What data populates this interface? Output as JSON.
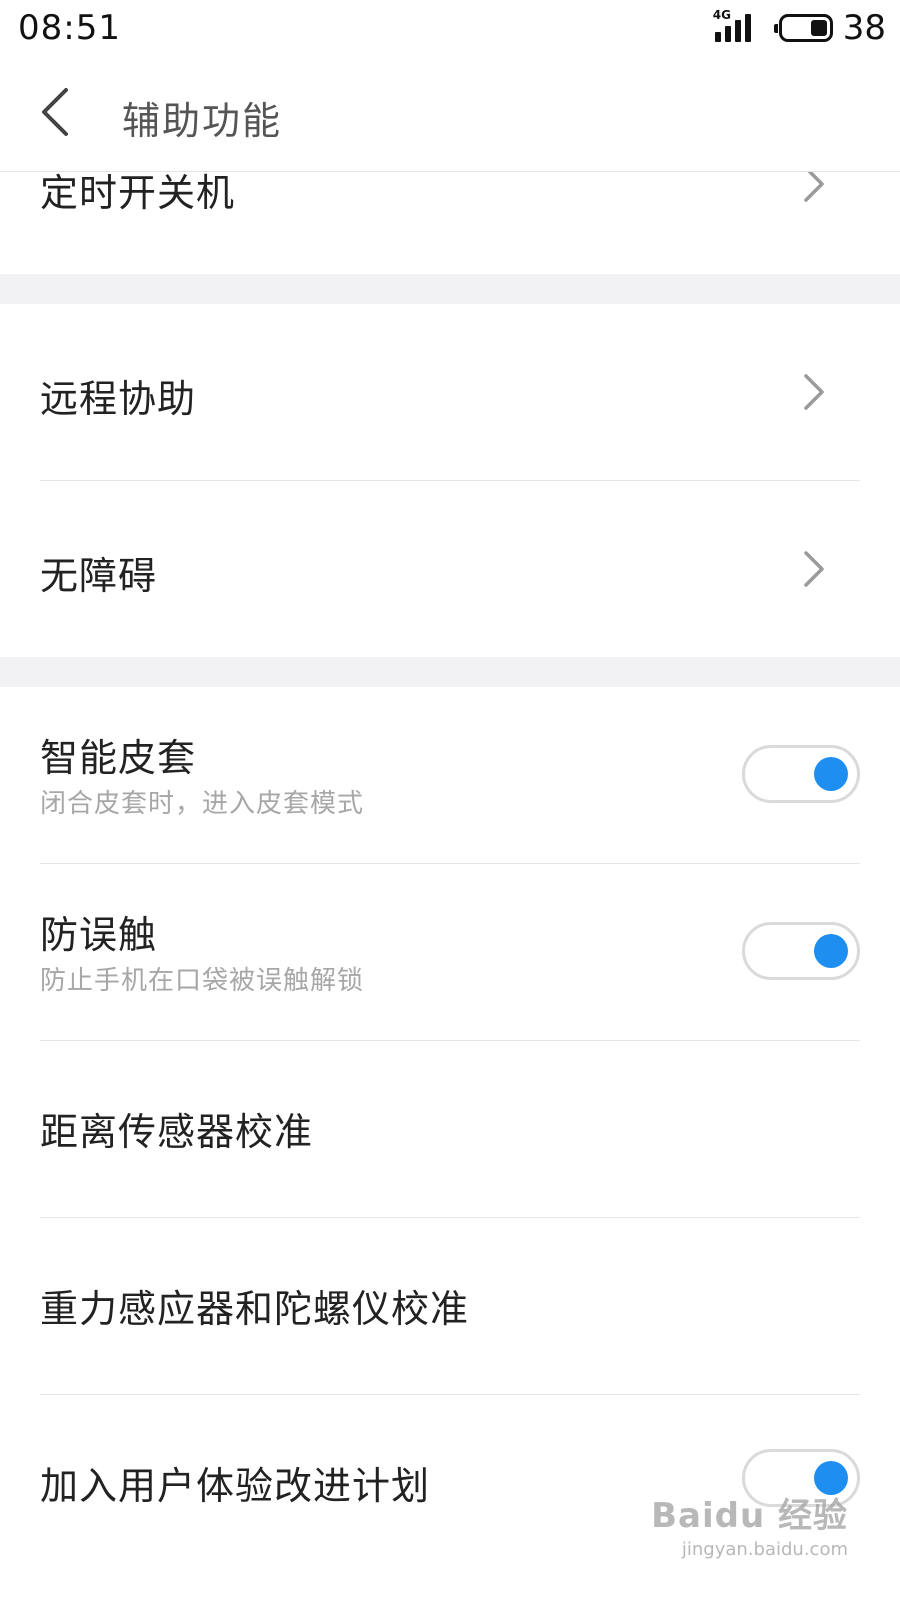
{
  "status_bar": {
    "time": "08:51",
    "network": "4G",
    "battery_percent": "38",
    "battery_level": 0.38
  },
  "header": {
    "title": "辅助功能",
    "back_icon": "chevron-left-icon"
  },
  "items": [
    {
      "title": "定时开关机",
      "type": "chevron"
    },
    {
      "title": "远程协助",
      "type": "chevron"
    },
    {
      "title": "无障碍",
      "type": "chevron"
    },
    {
      "title": "智能皮套",
      "subtitle": "闭合皮套时，进入皮套模式",
      "type": "toggle",
      "on": true
    },
    {
      "title": "防误触",
      "subtitle": "防止手机在口袋被误触解锁",
      "type": "toggle",
      "on": true
    },
    {
      "title": "距离传感器校准",
      "type": "plain"
    },
    {
      "title": "重力感应器和陀螺仪校准",
      "type": "plain"
    },
    {
      "title": "加入用户体验改进计划",
      "type": "toggle",
      "on": true
    }
  ],
  "colors": {
    "accent": "#1e8ef0",
    "section_gap": "#f2f2f4",
    "divider": "#e6e6e6"
  },
  "watermark": {
    "main": "Baidu 经验",
    "sub": "jingyan.baidu.com"
  }
}
